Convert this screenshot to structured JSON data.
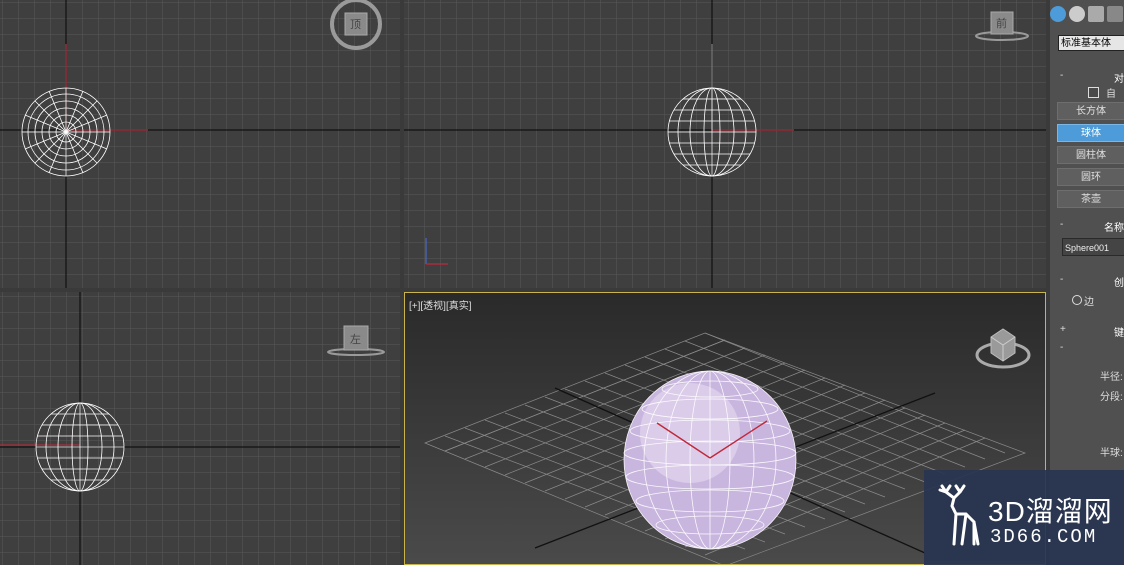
{
  "viewports": {
    "top_left": {
      "cube_label": "顶"
    },
    "top_right": {
      "cube_label": "前"
    },
    "bottom_left": {
      "cube_label": "左"
    },
    "perspective": {
      "label": "[+][透视][真实]"
    }
  },
  "command_panel": {
    "category_dropdown": "标准基本体",
    "object_type": {
      "header": "对",
      "autogrid_label": "自动",
      "buttons": [
        "长方体",
        "球体",
        "圆柱体",
        "圆环",
        "茶壶"
      ],
      "active_button": "球体"
    },
    "name_color": {
      "header": "名称",
      "object_name": "Sphere001"
    },
    "creation_method": {
      "header": "创",
      "edge_label": "边"
    },
    "keyboard_entry": {
      "header": "键",
      "toggle": "+"
    },
    "parameters": {
      "toggle": "-",
      "radius_label": "半径:",
      "segments_label": "分段:",
      "hemisphere_label": "半球:"
    }
  },
  "watermark": {
    "main_text": "3D溜溜网",
    "sub_text": "3D66.COM"
  },
  "colors": {
    "viewport_bg": "#3f3f3f",
    "grid_line": "#5a5a5a",
    "accent_active": "#4d9bd8",
    "sphere_fill": "#c9b6df"
  }
}
